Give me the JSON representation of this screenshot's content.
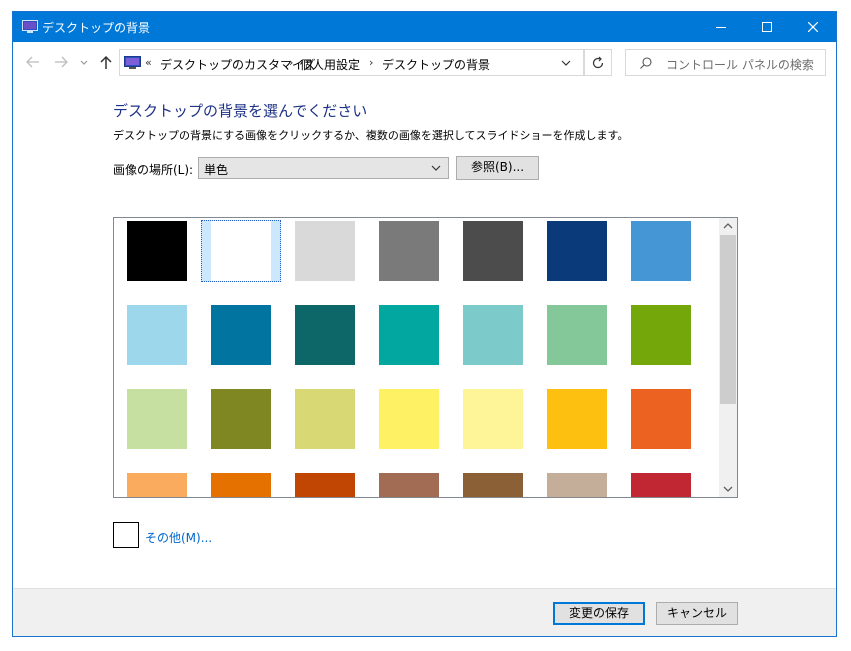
{
  "window": {
    "title": "デスクトップの背景"
  },
  "titlebar": {
    "minimize_icon": "minimize-icon",
    "maximize_icon": "maximize-icon",
    "close_icon": "close-icon"
  },
  "nav": {
    "back_icon": "arrow-left-icon",
    "forward_icon": "arrow-right-icon",
    "recent_icon": "chevron-down-icon",
    "up_icon": "arrow-up-icon"
  },
  "address": {
    "overflow": "«",
    "crumbs": [
      "デスクトップのカスタマイズ",
      "個人用設定",
      "デスクトップの背景"
    ],
    "separator": "›"
  },
  "search": {
    "placeholder": "コントロール パネルの検索"
  },
  "content": {
    "heading": "デスクトップの背景を選んでください",
    "description": "デスクトップの背景にする画像をクリックするか、複数の画像を選択してスライドショーを作成します。",
    "location_label": "画像の場所(L):",
    "location_value": "単色",
    "browse_label": "参照(B)..."
  },
  "colors": [
    [
      "#000000",
      "#ffffff",
      "#d9d9d9",
      "#7a7a7a",
      "#4c4c4c",
      "#0b3a7a",
      "#4596d4"
    ],
    [
      "#9cd7ec",
      "#01759f",
      "#0d6768",
      "#02a89f",
      "#7ccbca",
      "#84c89a",
      "#73a70a"
    ],
    [
      "#c5e0a0",
      "#7f8723",
      "#d8d874",
      "#fef264",
      "#fdf598",
      "#fec010",
      "#ec6220"
    ],
    [
      "#faab5d",
      "#e57100",
      "#c14603",
      "#a26b54",
      "#8c6037",
      "#c4ae9a",
      "#c12733"
    ]
  ],
  "selected": {
    "row": 0,
    "col": 1
  },
  "other": {
    "label": "その他(M)...",
    "color": "#ffffff"
  },
  "footer": {
    "save_label": "変更の保存",
    "cancel_label": "キャンセル"
  },
  "theme": {
    "accent": "#0078d7",
    "heading_color": "#1e3287",
    "link_color": "#0066cc"
  }
}
